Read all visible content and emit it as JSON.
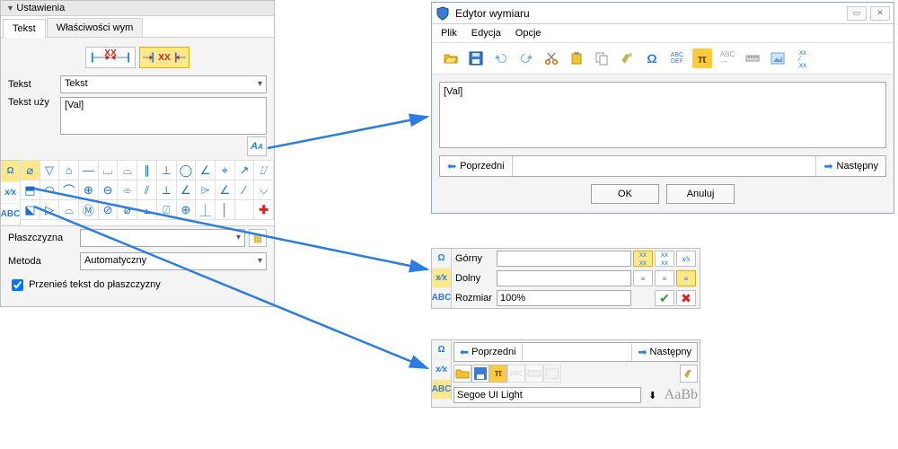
{
  "panel_title": "Ustawienia",
  "tabs": {
    "text": "Tekst",
    "props": "Właściwości wym"
  },
  "labels": {
    "tekst": "Tekst",
    "tekst_uzy": "Tekst uży",
    "plaszczyzna": "Płaszczyzna",
    "metoda": "Metoda",
    "przenies": "Przenieś tekst do płaszczyzny"
  },
  "combo_text": "Tekst",
  "textarea_value": "[Val]",
  "metoda_value": "Automatyczny",
  "side_buttons": [
    "Ω",
    "x⁄x",
    "ABC"
  ],
  "symbols_row1": [
    "⌀",
    "▽",
    "⌂",
    "—",
    "⌴",
    "⌓",
    "∥",
    "⊥",
    "◯",
    "∠",
    "⌖",
    "↗",
    "⌰"
  ],
  "symbols_row2": [
    "⬒",
    "◠",
    "⌒",
    "⊕",
    "⊖",
    "⌯",
    "⫽",
    "⟂",
    "∠",
    "⌲",
    "∠",
    "∕",
    "⌵"
  ],
  "symbols_row3": [
    "⬕",
    "▷",
    "⌓",
    "Ⓜ",
    "⊘",
    "⌀",
    "⫠",
    "⍁",
    "⊕",
    "⏊",
    "│",
    "",
    "✚"
  ],
  "editor": {
    "title": "Edytor wymiaru",
    "menu": [
      "Plik",
      "Edycja",
      "Opcje"
    ],
    "text_value": "[Val]",
    "prev": "Poprzedni",
    "next": "Następny",
    "ok": "OK",
    "cancel": "Anuluj"
  },
  "sp1": {
    "top": "Górny",
    "bottom": "Dolny",
    "size": "Rozmiar",
    "size_val": "100%"
  },
  "sp2": {
    "prev": "Poprzedni",
    "next": "Następny",
    "font": "Segoe UI Light",
    "sample": "AaBb"
  }
}
